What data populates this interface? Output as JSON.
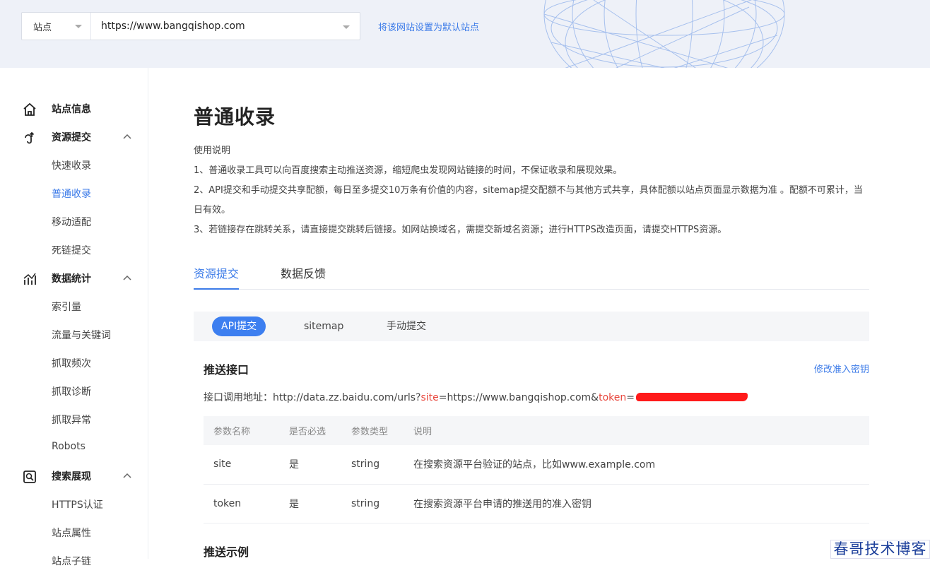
{
  "topbar": {
    "site_label": "站点",
    "site_url": "https://www.bangqishop.com",
    "set_default_link": "将该网站设置为默认站点"
  },
  "sidebar": {
    "groups": [
      {
        "label": "站点信息",
        "icon": "home-icon"
      },
      {
        "label": "资源提交",
        "icon": "submit-icon",
        "items": [
          "快速收录",
          "普通收录",
          "移动适配",
          "死链提交"
        ]
      },
      {
        "label": "数据统计",
        "icon": "stats-icon",
        "items": [
          "索引量",
          "流量与关键词",
          "抓取频次",
          "抓取诊断",
          "抓取异常",
          "Robots"
        ]
      },
      {
        "label": "搜索展现",
        "icon": "search-display-icon",
        "items": [
          "HTTPS认证",
          "站点属性",
          "站点子链"
        ]
      }
    ],
    "active_item": "普通收录"
  },
  "main": {
    "title": "普通收录",
    "desc": [
      "使用说明",
      "1、普通收录工具可以向百度搜索主动推送资源，缩短爬虫发现网站链接的时间，不保证收录和展现效果。",
      "2、API提交和手动提交共享配额，每日至多提交10万条有价值的内容，sitemap提交配额不与其他方式共享，具体配额以站点页面显示数据为准 。配额不可累计，当日有效。",
      "3、若链接存在跳转关系，请直接提交跳转后链接。如网站换域名，需提交新域名资源；进行HTTPS改造页面，请提交HTTPS资源。"
    ],
    "tabs": [
      "资源提交",
      "数据反馈"
    ],
    "subtabs": [
      "API提交",
      "sitemap",
      "手动提交"
    ],
    "push_section_title": "推送接口",
    "modify_key_link": "修改准入密钥",
    "api": {
      "prefix": "接口调用地址：http://data.zz.baidu.com/urls?",
      "site_key": "site",
      "site_value": "=https://www.bangqishop.com&",
      "token_key": "token",
      "token_value": "="
    },
    "params_table": {
      "headers": [
        "参数名称",
        "是否必选",
        "参数类型",
        "说明"
      ],
      "rows": [
        [
          "site",
          "是",
          "string",
          "在搜索资源平台验证的站点，比如www.example.com"
        ],
        [
          "token",
          "是",
          "string",
          "在搜索资源平台申请的推送用的准入密钥"
        ]
      ]
    },
    "example_section_title": "推送示例"
  },
  "watermark": "春哥技术博客",
  "colors": {
    "accent": "#3c7be8",
    "param_red": "#e8463c",
    "watermark": "#1a3d9a"
  }
}
